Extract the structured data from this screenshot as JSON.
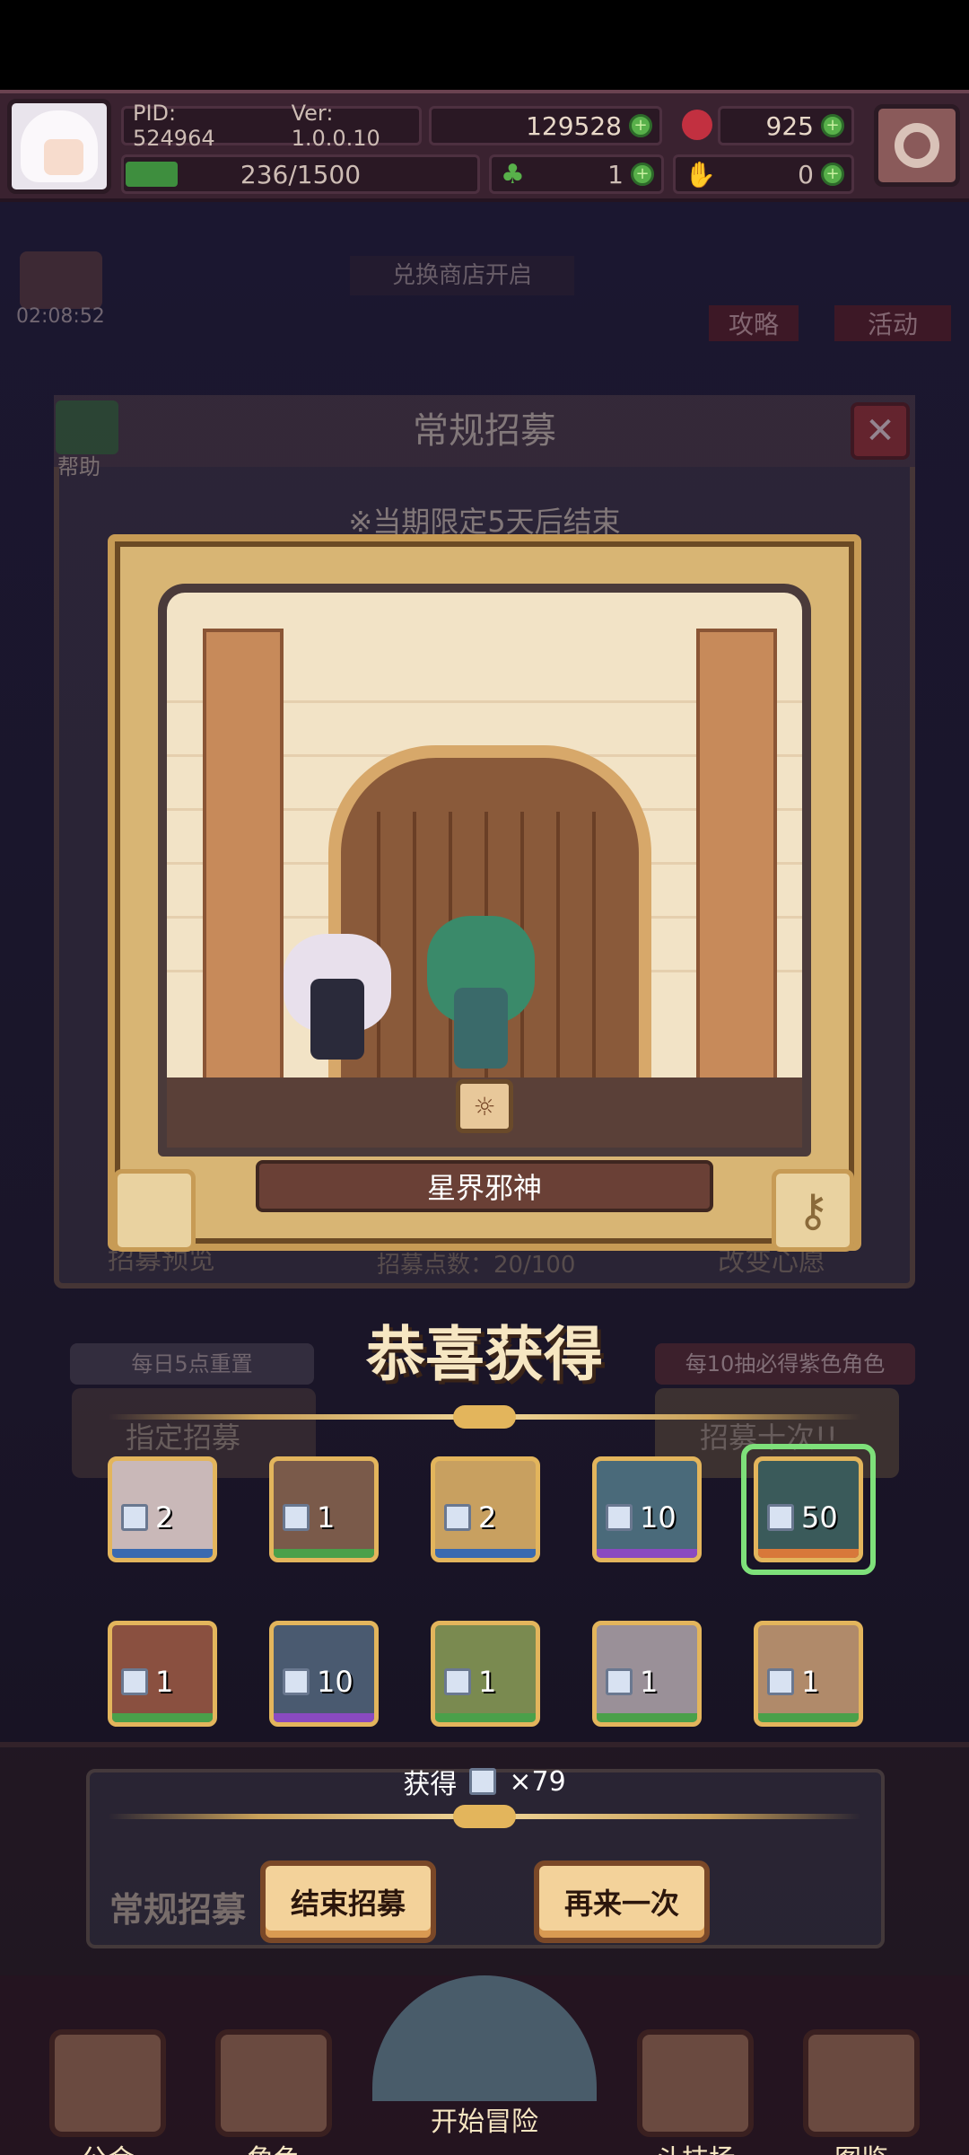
{
  "hud": {
    "pid": "PID: 524964",
    "ver": "Ver: 1.0.0.10",
    "gold": "129528",
    "ruby": "925",
    "stamina": "236/1500",
    "clover": "1",
    "hand": "0"
  },
  "background": {
    "timer": "02:08:52",
    "shop_label": "兑换商店开启",
    "guide_label": "攻略",
    "event_label": "活动",
    "panel_title": "常规招募",
    "help_label": "帮助",
    "limited_notice": "※当期限定5天后结束",
    "preview_label": "招募预览",
    "points_label": "招募点数：20/100",
    "change_label": "改变心愿",
    "daily_reset": "每日5点重置",
    "guarantee": "每10抽必得紫色角色",
    "left_btn": "指定招募",
    "right_btn": "招募十次!!",
    "bottom_banner": "常规招募"
  },
  "result": {
    "character_name": "星界邪神",
    "congrats": "恭喜获得",
    "total_label": "获得",
    "total_count": "×79",
    "cards": [
      {
        "count": "2",
        "color": "#3a6ab0",
        "bg": "#c9b8b8"
      },
      {
        "count": "1",
        "color": "#4aa04a",
        "bg": "#7a5a4a"
      },
      {
        "count": "2",
        "color": "#3a6ab0",
        "bg": "#c8a060"
      },
      {
        "count": "10",
        "color": "#8a4ac0",
        "bg": "#4a6a7a"
      },
      {
        "count": "50",
        "color": "#d8783a",
        "bg": "#3a5a5a"
      },
      {
        "count": "1",
        "color": "#4aa04a",
        "bg": "#8a5040"
      },
      {
        "count": "10",
        "color": "#8a4ac0",
        "bg": "#4a5a70"
      },
      {
        "count": "1",
        "color": "#4aa04a",
        "bg": "#7a8a50"
      },
      {
        "count": "1",
        "color": "#4aa04a",
        "bg": "#9a9098"
      },
      {
        "count": "1",
        "color": "#4aa04a",
        "bg": "#b08a6a"
      }
    ],
    "end_button": "结束招募",
    "again_button": "再来一次"
  },
  "nav": {
    "guild": "公会",
    "role": "角色",
    "adventure": "开始冒险",
    "arena": "斗技场",
    "book": "图鉴"
  },
  "colors": {
    "accent": "#e3b55c",
    "selected": "#7ee07a"
  }
}
